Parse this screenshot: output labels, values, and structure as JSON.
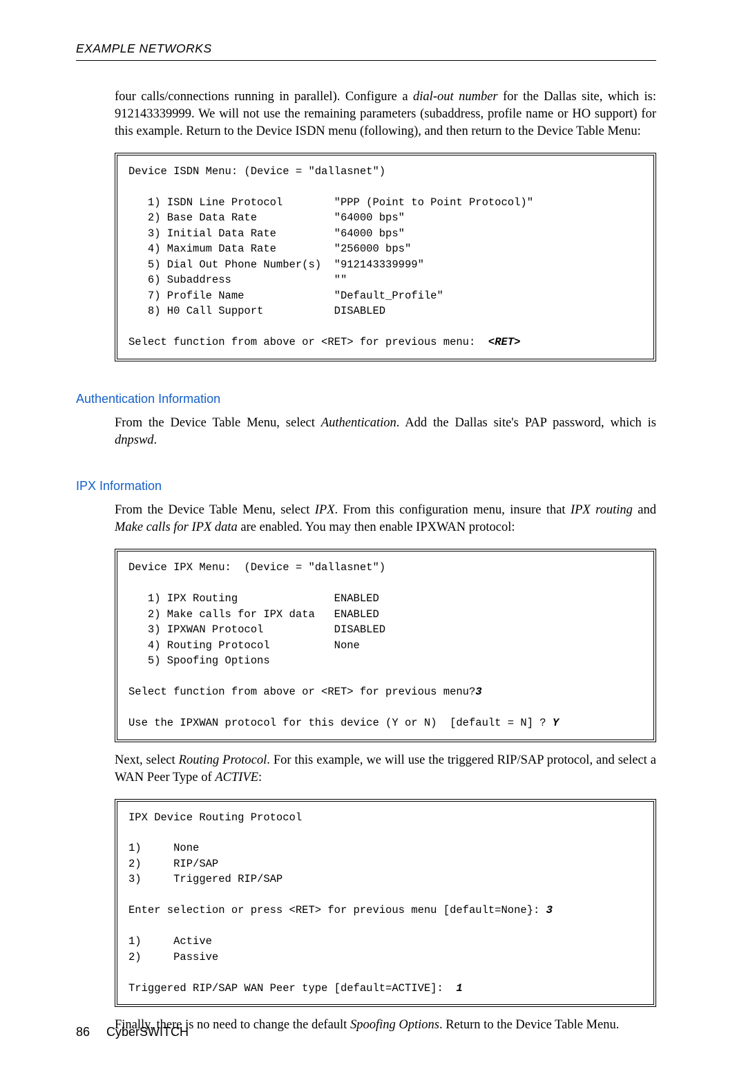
{
  "header": {
    "running": "EXAMPLE NETWORKS"
  },
  "p1": {
    "a": "four calls/connections running in parallel). Configure a ",
    "b": "dial-out number",
    "c": " for the Dallas site, which is: 912143339999. We will not use the remaining parameters (subaddress, profile name or HO support) for this example. Return to the Device ISDN menu (following), and then return to the Device Table Menu:"
  },
  "term1": {
    "title": "Device ISDN Menu: (Device = \"dallasnet\")",
    "l1": "   1) ISDN Line Protocol        \"PPP (Point to Point Protocol)\"",
    "l2": "   2) Base Data Rate            \"64000 bps\"",
    "l3": "   3) Initial Data Rate         \"64000 bps\"",
    "l4": "   4) Maximum Data Rate         \"256000 bps\"",
    "l5": "   5) Dial Out Phone Number(s)  \"912143339999\"",
    "l6": "   6) Subaddress                \"\"",
    "l7": "   7) Profile Name              \"Default_Profile\"",
    "l8": "   8) H0 Call Support           DISABLED",
    "prompt": "Select function from above or <RET> for previous menu:  ",
    "input": "<RET>"
  },
  "sec_auth": "Authentication Information",
  "p_auth": {
    "a": "From the Device Table Menu, select ",
    "b": "Authentication",
    "c": ". Add the Dallas site's PAP password, which is ",
    "d": "dnpswd",
    "e": "."
  },
  "sec_ipx": "IPX Information",
  "p_ipx1": {
    "a": "From the Device Table Menu, select ",
    "b": "IPX",
    "c": ". From this configuration menu, insure that ",
    "d": "IPX routing",
    "e": " and ",
    "f": "Make calls for IPX data",
    "g": " are enabled. You may then enable IPXWAN protocol:"
  },
  "term2": {
    "title": "Device IPX Menu:  (Device = \"dallasnet\")",
    "l1": "   1) IPX Routing               ENABLED",
    "l2": "   2) Make calls for IPX data   ENABLED",
    "l3": "   3) IPXWAN Protocol           DISABLED",
    "l4": "   4) Routing Protocol          None",
    "l5": "   5) Spoofing Options",
    "prompt1a": "Select function from above or <RET> for previous menu?",
    "prompt1b": "3",
    "prompt2a": "Use the IPXWAN protocol for this device (Y or N)  [default = N] ? ",
    "prompt2b": "Y"
  },
  "p_ipx2": {
    "a": "Next, select ",
    "b": "Routing Protocol",
    "c": ". For this example, we will use the triggered RIP/SAP protocol, and select a WAN Peer Type of ",
    "d": "ACTIVE",
    "e": ":"
  },
  "term3": {
    "title": "IPX Device Routing Protocol",
    "l1": "1)     None",
    "l2": "2)     RIP/SAP",
    "l3": "3)     Triggered RIP/SAP",
    "prompt1a": "Enter selection or press <RET> for previous menu [default=None}: ",
    "prompt1b": "3",
    "l4": "1)     Active",
    "l5": "2)     Passive",
    "prompt2a": "Triggered RIP/SAP WAN Peer type [default=ACTIVE]:  ",
    "prompt2b": "1"
  },
  "p_final": {
    "a": "Finally, there is no need to change the default ",
    "b": "Spoofing Options",
    "c": ". Return to the Device Table Menu."
  },
  "footer": {
    "page": "86",
    "product": "CyberSWITCH"
  }
}
